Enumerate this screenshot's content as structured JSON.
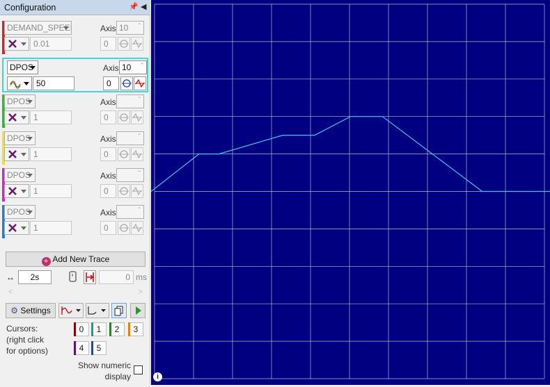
{
  "panel": {
    "title": "Configuration",
    "pin_icon": "pin-icon",
    "collapse_icon": "collapse-left-icon"
  },
  "traces": [
    {
      "parameter": "DEMAND_SPEED",
      "axis_label": "Axis",
      "axis": "10",
      "scale": "0.01",
      "offset": "0",
      "color": "#e02020",
      "active": false,
      "style_icon": "cross-icon"
    },
    {
      "parameter": "DPOS",
      "axis_label": "Axis",
      "axis": "10",
      "scale": "50",
      "offset": "0",
      "color": "#38dada",
      "active": true,
      "style_icon": "wave-icon"
    },
    {
      "parameter": "DPOS",
      "axis_label": "Axis",
      "axis": "",
      "scale": "1",
      "offset": "0",
      "color": "#22c422",
      "active": false,
      "style_icon": "cross-icon"
    },
    {
      "parameter": "DPOS",
      "axis_label": "Axis",
      "axis": "",
      "scale": "1",
      "offset": "0",
      "color": "#f2e41c",
      "active": false,
      "style_icon": "cross-icon"
    },
    {
      "parameter": "DPOS",
      "axis_label": "Axis",
      "axis": "",
      "scale": "1",
      "offset": "0",
      "color": "#e01ccf",
      "active": false,
      "style_icon": "cross-icon"
    },
    {
      "parameter": "DPOS",
      "axis_label": "Axis",
      "axis": "",
      "scale": "1",
      "offset": "0",
      "color": "#1f7fe0",
      "active": false,
      "style_icon": "cross-icon"
    }
  ],
  "add_trace_label": "Add New Trace",
  "timebase": {
    "value": "2s"
  },
  "trigger": {
    "value": "0",
    "unit": "ms"
  },
  "toolbar": {
    "settings_label": "Settings"
  },
  "cursors": {
    "label": "Cursors:\n(right click\nfor options)",
    "buttons": [
      {
        "label": "0",
        "color": "#8b0000"
      },
      {
        "label": "1",
        "color": "#1a9a9a"
      },
      {
        "label": "2",
        "color": "#1a8a1a"
      },
      {
        "label": "3",
        "color": "#e08010"
      },
      {
        "label": "4",
        "color": "#6a0a8a"
      },
      {
        "label": "5",
        "color": "#1a4ab0"
      }
    ]
  },
  "numeric_display_label": "Show numeric\ndisplay",
  "chart_data": {
    "type": "line",
    "series": [
      {
        "x": [
          0,
          0.12,
          0.17,
          0.33,
          0.41,
          0.5,
          0.58,
          0.83,
          0.9,
          1.0
        ],
        "y": [
          0,
          1.0,
          1.0,
          1.5,
          1.5,
          2.0,
          2.0,
          0.0,
          0.0,
          0.0
        ]
      }
    ],
    "xlim": [
      0,
      1
    ],
    "ylim": [
      -5,
      5
    ],
    "grid": true,
    "line_color": "#3fc6f0",
    "background": "#000080",
    "grid_color": "#b8b8c8"
  }
}
